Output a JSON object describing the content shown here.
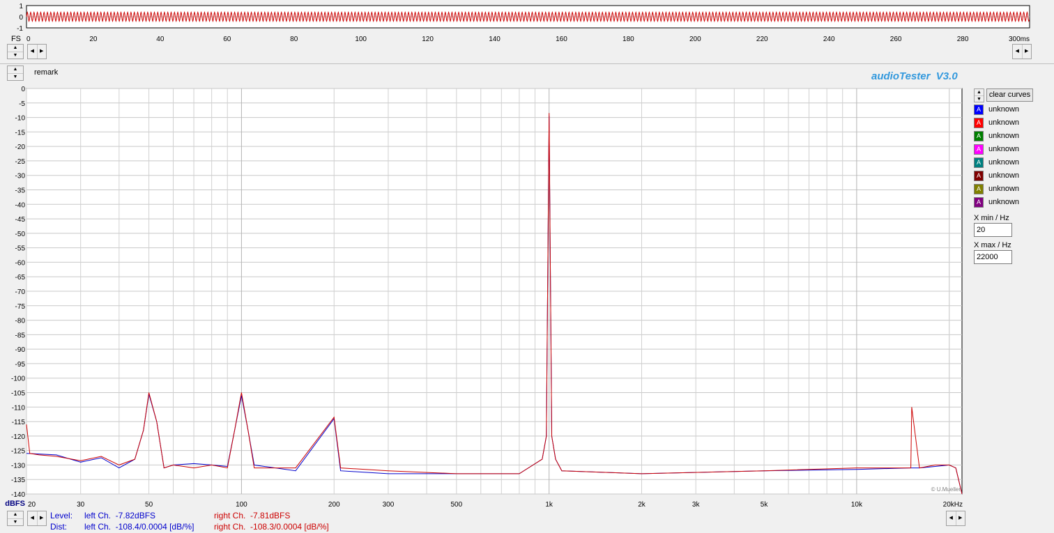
{
  "app": {
    "logo": "audioTester  V3.0",
    "remark_label": "remark",
    "copyright": "© U.Mueller"
  },
  "toolbar": {
    "clear_curves": "clear curves",
    "xmin_label": "X min / Hz",
    "xmin_value": "20",
    "xmax_label": "X max / Hz",
    "xmax_value": "22000"
  },
  "legend": [
    {
      "name": "unknown",
      "color": "#0000ff",
      "glyph": "A"
    },
    {
      "name": "unknown",
      "color": "#ff0000",
      "glyph": "A"
    },
    {
      "name": "unknown",
      "color": "#008000",
      "glyph": "A"
    },
    {
      "name": "unknown",
      "color": "#ff00ff",
      "glyph": "A"
    },
    {
      "name": "unknown",
      "color": "#008080",
      "glyph": "A"
    },
    {
      "name": "unknown",
      "color": "#800000",
      "glyph": "A"
    },
    {
      "name": "unknown",
      "color": "#808000",
      "glyph": "A"
    },
    {
      "name": "unknown",
      "color": "#800080",
      "glyph": "A"
    }
  ],
  "status": {
    "level_label": "Level:",
    "dist_label": "Dist:",
    "level_left": "left Ch.  -7.82dBFS",
    "level_right": "right Ch.  -7.81dBFS",
    "dist_left": "left Ch.  -108.4/0.0004 [dB/%]",
    "dist_right": "right Ch.  -108.3/0.0004 [dB/%]",
    "left_color": "#0000cc",
    "right_color": "#cc0000"
  },
  "chart_data": [
    {
      "type": "line",
      "title": "",
      "x_unit": "ms",
      "y_unit": "FS",
      "xlim": [
        0,
        300
      ],
      "ylim": [
        -1,
        1
      ],
      "x_ticks": [
        0,
        20,
        40,
        60,
        80,
        100,
        120,
        140,
        160,
        180,
        200,
        220,
        240,
        260,
        280,
        300
      ],
      "x_tick_labels": [
        "0",
        "20",
        "40",
        "60",
        "80",
        "100",
        "120",
        "140",
        "160",
        "180",
        "200",
        "220",
        "240",
        "260",
        "280",
        "300ms"
      ],
      "y_tick_labels": [
        "1",
        "0",
        "-1"
      ],
      "y_unit_label": "FS",
      "series": [
        {
          "color": "#cc0000",
          "frequency_hz": 1000,
          "amplitude": 0.4
        }
      ]
    },
    {
      "type": "line",
      "title": "",
      "x_scale": "log",
      "xlim": [
        20,
        22000
      ],
      "ylim": [
        -140,
        0
      ],
      "y_unit_label": "dBFS",
      "x_ticks": [
        20,
        30,
        50,
        100,
        200,
        300,
        500,
        1000,
        2000,
        3000,
        5000,
        10000,
        20000
      ],
      "x_tick_labels": [
        "20",
        "30",
        "50",
        "100",
        "200",
        "300",
        "500",
        "1k",
        "2k",
        "3k",
        "5k",
        "10k",
        "20kHz"
      ],
      "y_ticks": [
        0,
        -5,
        -10,
        -15,
        -20,
        -25,
        -30,
        -35,
        -40,
        -45,
        -50,
        -55,
        -60,
        -65,
        -70,
        -75,
        -80,
        -85,
        -90,
        -95,
        -100,
        -105,
        -110,
        -115,
        -120,
        -125,
        -130,
        -135,
        -140
      ],
      "grid": true,
      "series": [
        {
          "channel": "left",
          "color": "#0000cc",
          "x": [
            20,
            25,
            30,
            35,
            40,
            45,
            48,
            50,
            53,
            56,
            60,
            70,
            80,
            90,
            95,
            100,
            105,
            110,
            150,
            200,
            210,
            300,
            500,
            800,
            950,
            980,
            1000,
            1020,
            1050,
            1100,
            2000,
            5000,
            10000,
            15000,
            16000,
            18000,
            20000,
            21000,
            22000
          ],
          "y": [
            -126,
            -126.5,
            -129,
            -127.5,
            -131,
            -128,
            -118,
            -105.5,
            -115,
            -131,
            -130,
            -129.5,
            -130,
            -130.5,
            -118,
            -106,
            -118,
            -130,
            -132,
            -114,
            -132,
            -133,
            -133,
            -133,
            -128,
            -120,
            -9.5,
            -120,
            -128,
            -132,
            -133,
            -132,
            -131.5,
            -131,
            -131,
            -130.5,
            -130,
            -131,
            -140
          ]
        },
        {
          "channel": "right",
          "color": "#cc0000",
          "x": [
            20,
            20.5,
            22,
            25,
            30,
            35,
            40,
            45,
            48,
            50,
            53,
            56,
            60,
            70,
            80,
            90,
            95,
            100,
            105,
            110,
            150,
            200,
            210,
            300,
            500,
            800,
            950,
            980,
            1000,
            1020,
            1050,
            1100,
            2000,
            5000,
            10000,
            15000,
            15100,
            16000,
            18000,
            20000,
            21000,
            22000
          ],
          "y": [
            -116,
            -126,
            -126.5,
            -127,
            -128.5,
            -127,
            -130,
            -128,
            -118,
            -105,
            -115,
            -131,
            -130,
            -131,
            -130,
            -131,
            -118,
            -105,
            -118,
            -131,
            -131,
            -113.5,
            -131,
            -132,
            -133,
            -133,
            -128,
            -120,
            -8.5,
            -120,
            -128,
            -132,
            -133,
            -132,
            -131,
            -131,
            -110,
            -131,
            -130,
            -130,
            -131,
            -140
          ]
        }
      ],
      "annotations": [
        "© U.Mueller"
      ]
    }
  ]
}
